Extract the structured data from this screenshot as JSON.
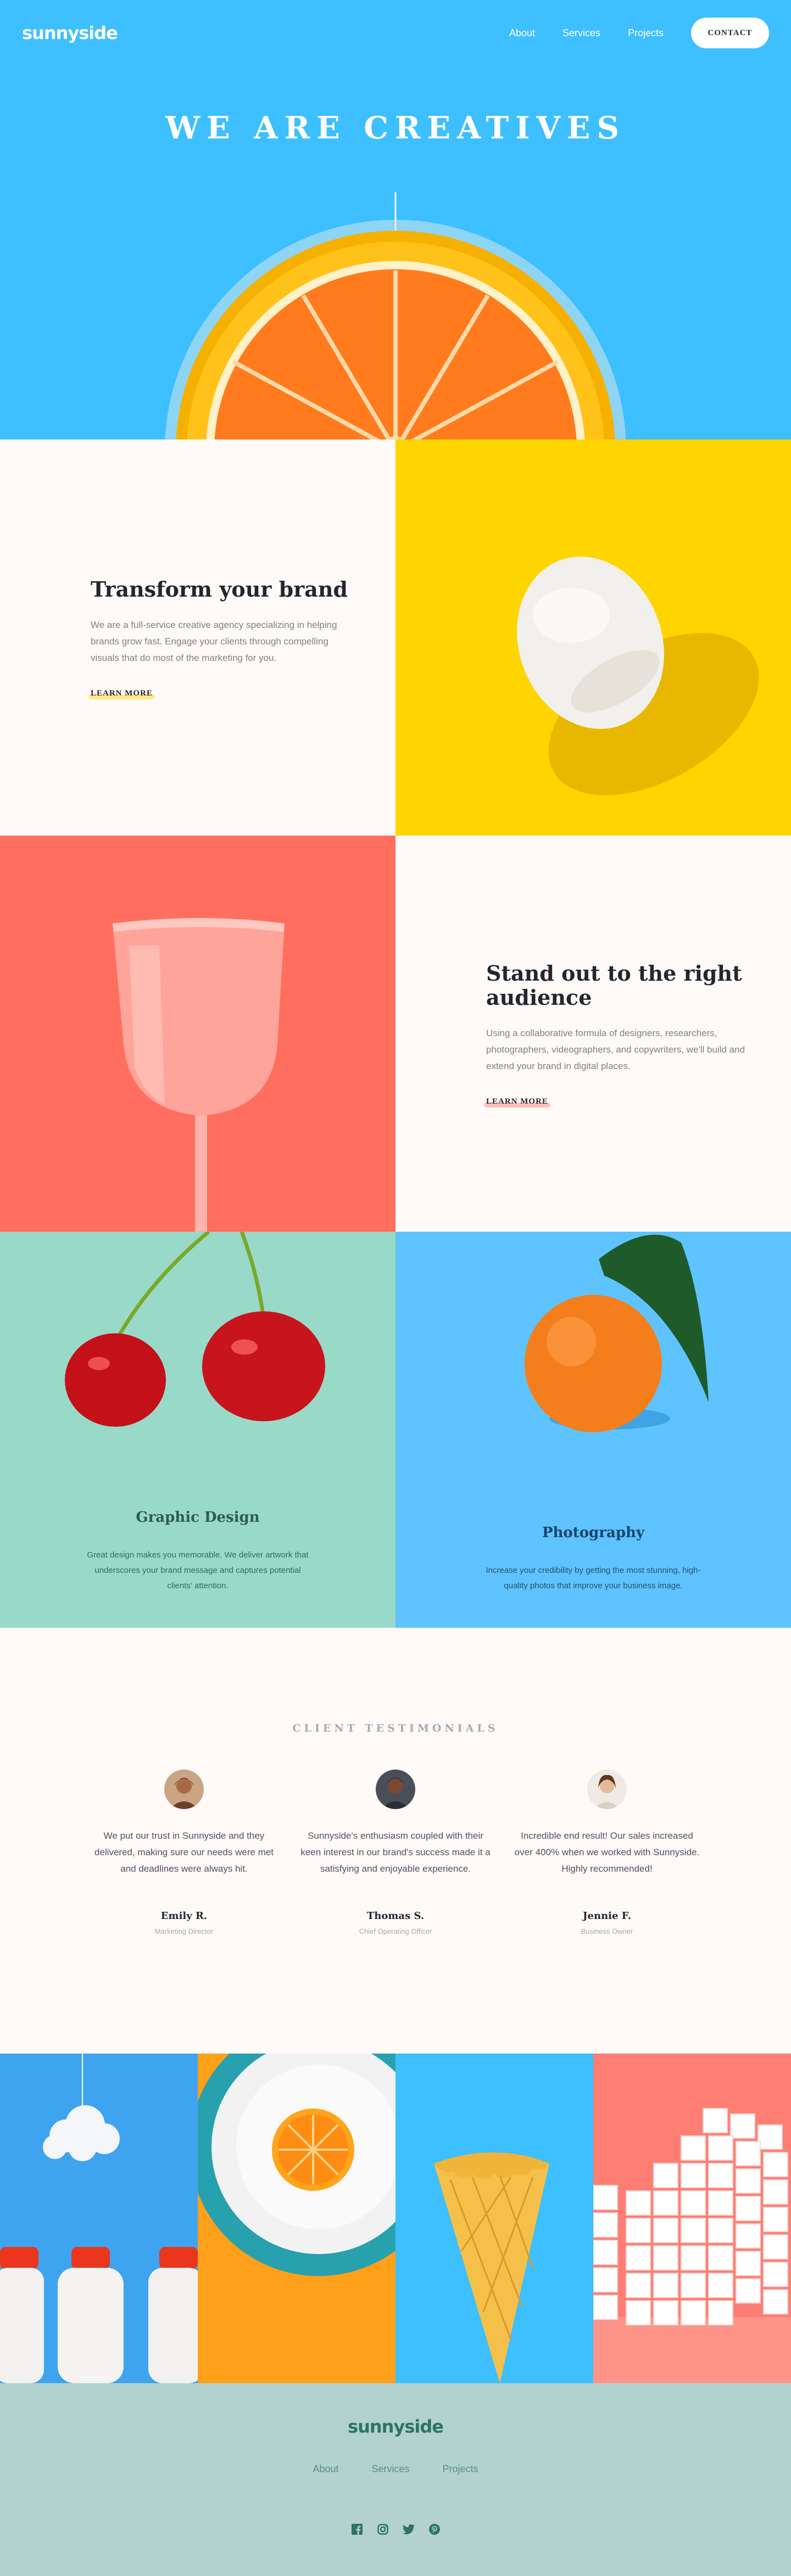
{
  "header": {
    "logo": "sunnyside",
    "nav": [
      "About",
      "Services",
      "Projects"
    ],
    "contact_label": "CONTACT"
  },
  "hero": {
    "title": "WE ARE CREATIVES",
    "arrow_icon": "arrow-down-icon"
  },
  "features": [
    {
      "title": "Transform your brand",
      "body": "We are a full-service creative agency specializing in helping brands grow fast. Engage your clients through compelling visuals that do most of the marketing for you.",
      "link": "LEARN MORE",
      "image": "egg-image",
      "accent": "#fad400"
    },
    {
      "title": "Stand out to the right audience",
      "body": "Using a collaborative formula of designers, researchers, photographers, videographers, and copywriters, we'll build and extend your brand in digital places.",
      "link": "LEARN MORE",
      "image": "cup-image",
      "accent": "#fe7867"
    }
  ],
  "services": [
    {
      "title": "Graphic Design",
      "body": "Great design makes you memorable. We deliver artwork that underscores your brand message and captures potential clients' attention.",
      "image": "cherries-image",
      "background": "#99d9c8"
    },
    {
      "title": "Photography",
      "body": "Increase your credibility by getting the most stunning, high-quality photos that improve your business image.",
      "image": "orange-image",
      "background": "#5ec3ff"
    }
  ],
  "testimonials": {
    "heading": "CLIENT TESTIMONIALS",
    "items": [
      {
        "quote": "We put our trust in Sunnyside and they delivered, making sure our needs were met and deadlines were always hit.",
        "name": "Emily R.",
        "role": "Marketing Director"
      },
      {
        "quote": "Sunnyside's enthusiasm coupled with their keen interest in our brand's success made it a satisfying and enjoyable experience.",
        "name": "Thomas S.",
        "role": "Chief Operating Officer"
      },
      {
        "quote": "Incredible end result! Our sales increased over 400% when we worked with Sunnyside. Highly recommended!",
        "name": "Jennie F.",
        "role": "Business Owner"
      }
    ]
  },
  "gallery": [
    "milk-bottles-image",
    "orange-plate-image",
    "ice-cream-cone-image",
    "sugar-cubes-image"
  ],
  "footer": {
    "logo": "sunnyside",
    "nav": [
      "About",
      "Services",
      "Projects"
    ],
    "social": [
      "facebook-icon",
      "instagram-icon",
      "twitter-icon",
      "pinterest-icon"
    ]
  },
  "colors": {
    "hero_blue": "#3ebfff",
    "cream": "#fff9f7",
    "egg_yellow": "#ffd500",
    "coral": "#ff6e5e",
    "mint": "#99d9c8",
    "footer_green": "#b3d2cd"
  }
}
